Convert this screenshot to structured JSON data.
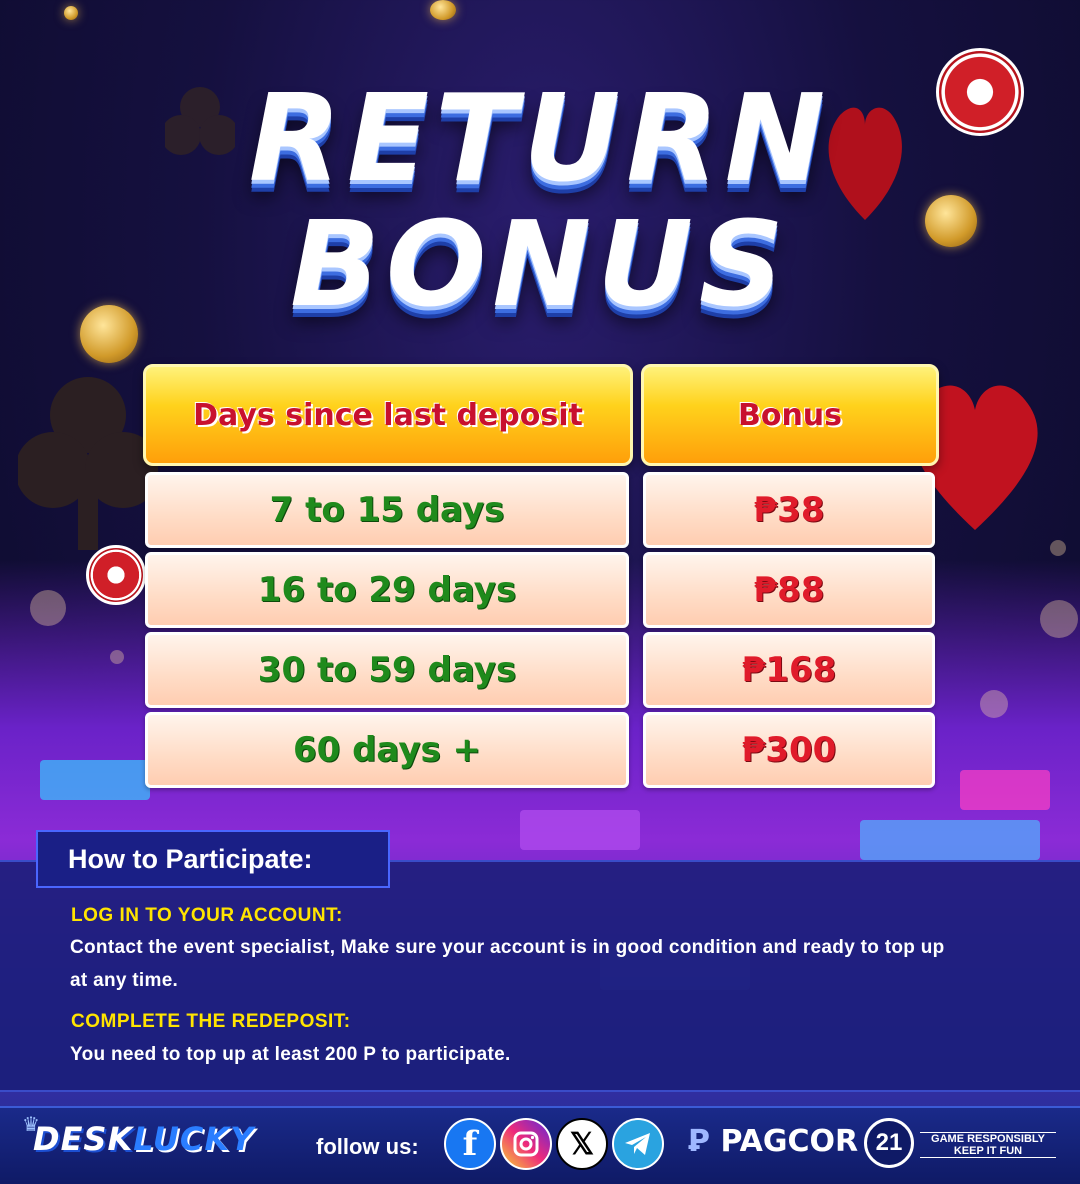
{
  "title": {
    "line1": "RETURN",
    "line2": "BONUS"
  },
  "table": {
    "header_days": "Days since last deposit",
    "header_bonus": "Bonus",
    "rows": [
      {
        "days": "7 to 15 days",
        "bonus": "₱38"
      },
      {
        "days": "16 to 29 days",
        "bonus": "₱88"
      },
      {
        "days": "30 to 59 days",
        "bonus": "₱168"
      },
      {
        "days": "60 days +",
        "bonus": "₱300"
      }
    ]
  },
  "how": {
    "heading": "How to Participate:",
    "steps": [
      {
        "title": "LOG IN TO YOUR ACCOUNT:",
        "text": "Contact the event specialist, Make sure your account is in good condition and ready to top up at any time."
      },
      {
        "title": "COMPLETE THE REDEPOSIT:",
        "text": "You need to top up at least 200 P to participate."
      }
    ]
  },
  "footer": {
    "logo_part1": "DESK",
    "logo_part2": "LUCKY",
    "follow_label": "follow us:",
    "social": [
      "facebook-icon",
      "instagram-icon",
      "x-icon",
      "telegram-icon"
    ],
    "pagcor": "PAGCOR",
    "age_badge": "21",
    "responsible_line1": "GAME RESPONSIBLY",
    "responsible_line2": "KEEP IT FUN"
  },
  "colors": {
    "header_text": "#c8102e",
    "days_text": "#1f8a1c",
    "bonus_text": "#e01b2a",
    "step_title": "#ffe400"
  }
}
